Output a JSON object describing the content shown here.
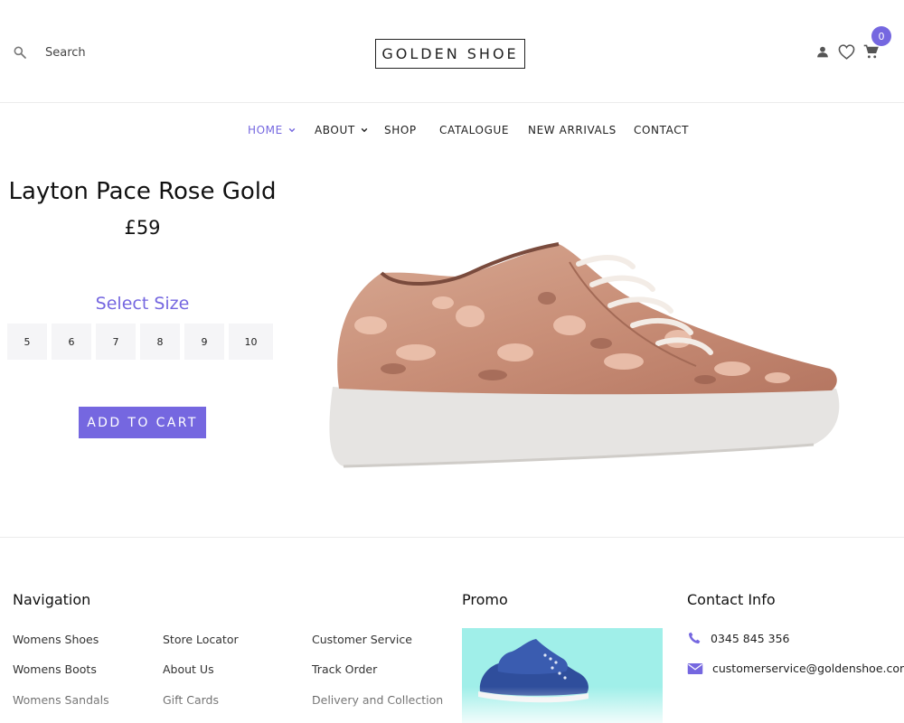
{
  "header": {
    "search_label": "Search",
    "logo_text": "GOLDEN SHOE",
    "cart_count": "0",
    "icons": [
      "search-icon",
      "user-icon",
      "heart-icon",
      "cart-icon"
    ]
  },
  "nav": {
    "items": [
      {
        "label": "HOME",
        "active": true,
        "dropdown": true
      },
      {
        "label": "ABOUT",
        "active": false,
        "dropdown": true
      },
      {
        "label": "SHOP",
        "active": false,
        "dropdown": false
      },
      {
        "label": "CATALOGUE",
        "active": false,
        "dropdown": false
      },
      {
        "label": "NEW ARRIVALS",
        "active": false,
        "dropdown": false
      },
      {
        "label": "CONTACT",
        "active": false,
        "dropdown": false
      }
    ]
  },
  "product": {
    "title": "Layton Pace Rose Gold",
    "price": "£59",
    "select_size_label": "Select Size",
    "sizes": [
      "5",
      "6",
      "7",
      "8",
      "9",
      "10"
    ],
    "add_to_cart_label": "ADD TO CART"
  },
  "footer": {
    "navigation_heading": "Navigation",
    "col1": [
      "Womens Shoes",
      "Womens Boots",
      "Womens Sandals"
    ],
    "col2": [
      "Store Locator",
      "About Us",
      "Gift Cards"
    ],
    "col3": [
      "Customer Service",
      "Track Order",
      "Delivery and Collection"
    ],
    "promo_heading": "Promo",
    "contact_heading": "Contact Info",
    "phone": "0345 845 356",
    "email": "customerservice@goldenshoe.com"
  },
  "colors": {
    "accent": "#7567e0",
    "promo_bg": "#a0efe9",
    "size_bg": "#f5f5f7"
  }
}
